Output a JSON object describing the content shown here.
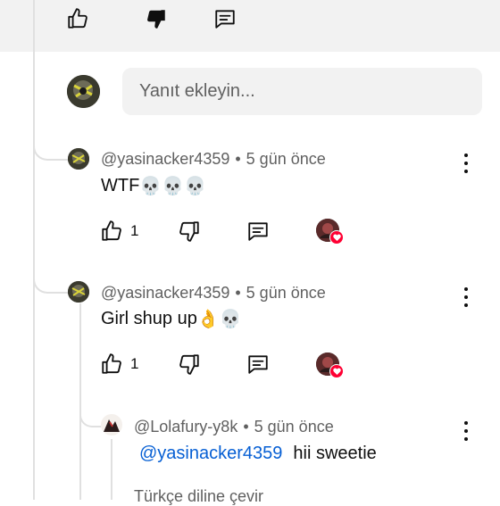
{
  "reply_input": {
    "placeholder": "Yanıt ekleyin..."
  },
  "comments": [
    {
      "author": "@yasinacker4359",
      "time": "5 gün önce",
      "text": "WTF",
      "emoji": "💀💀💀",
      "likes": "1"
    },
    {
      "author": "@yasinacker4359",
      "time": "5 gün önce",
      "text": "Girl shup up",
      "emoji": "👌💀",
      "likes": "1"
    }
  ],
  "reply": {
    "author": "@Lolafury-y8k",
    "time": "5 gün önce",
    "mention": "@yasinacker4359",
    "text": "hii sweetie",
    "translate": "Türkçe diline çevir"
  },
  "meta_separator": "•",
  "colors": {
    "like_heart": "#ff0033",
    "mention": "#065fd4",
    "secondary_text": "#606060"
  }
}
